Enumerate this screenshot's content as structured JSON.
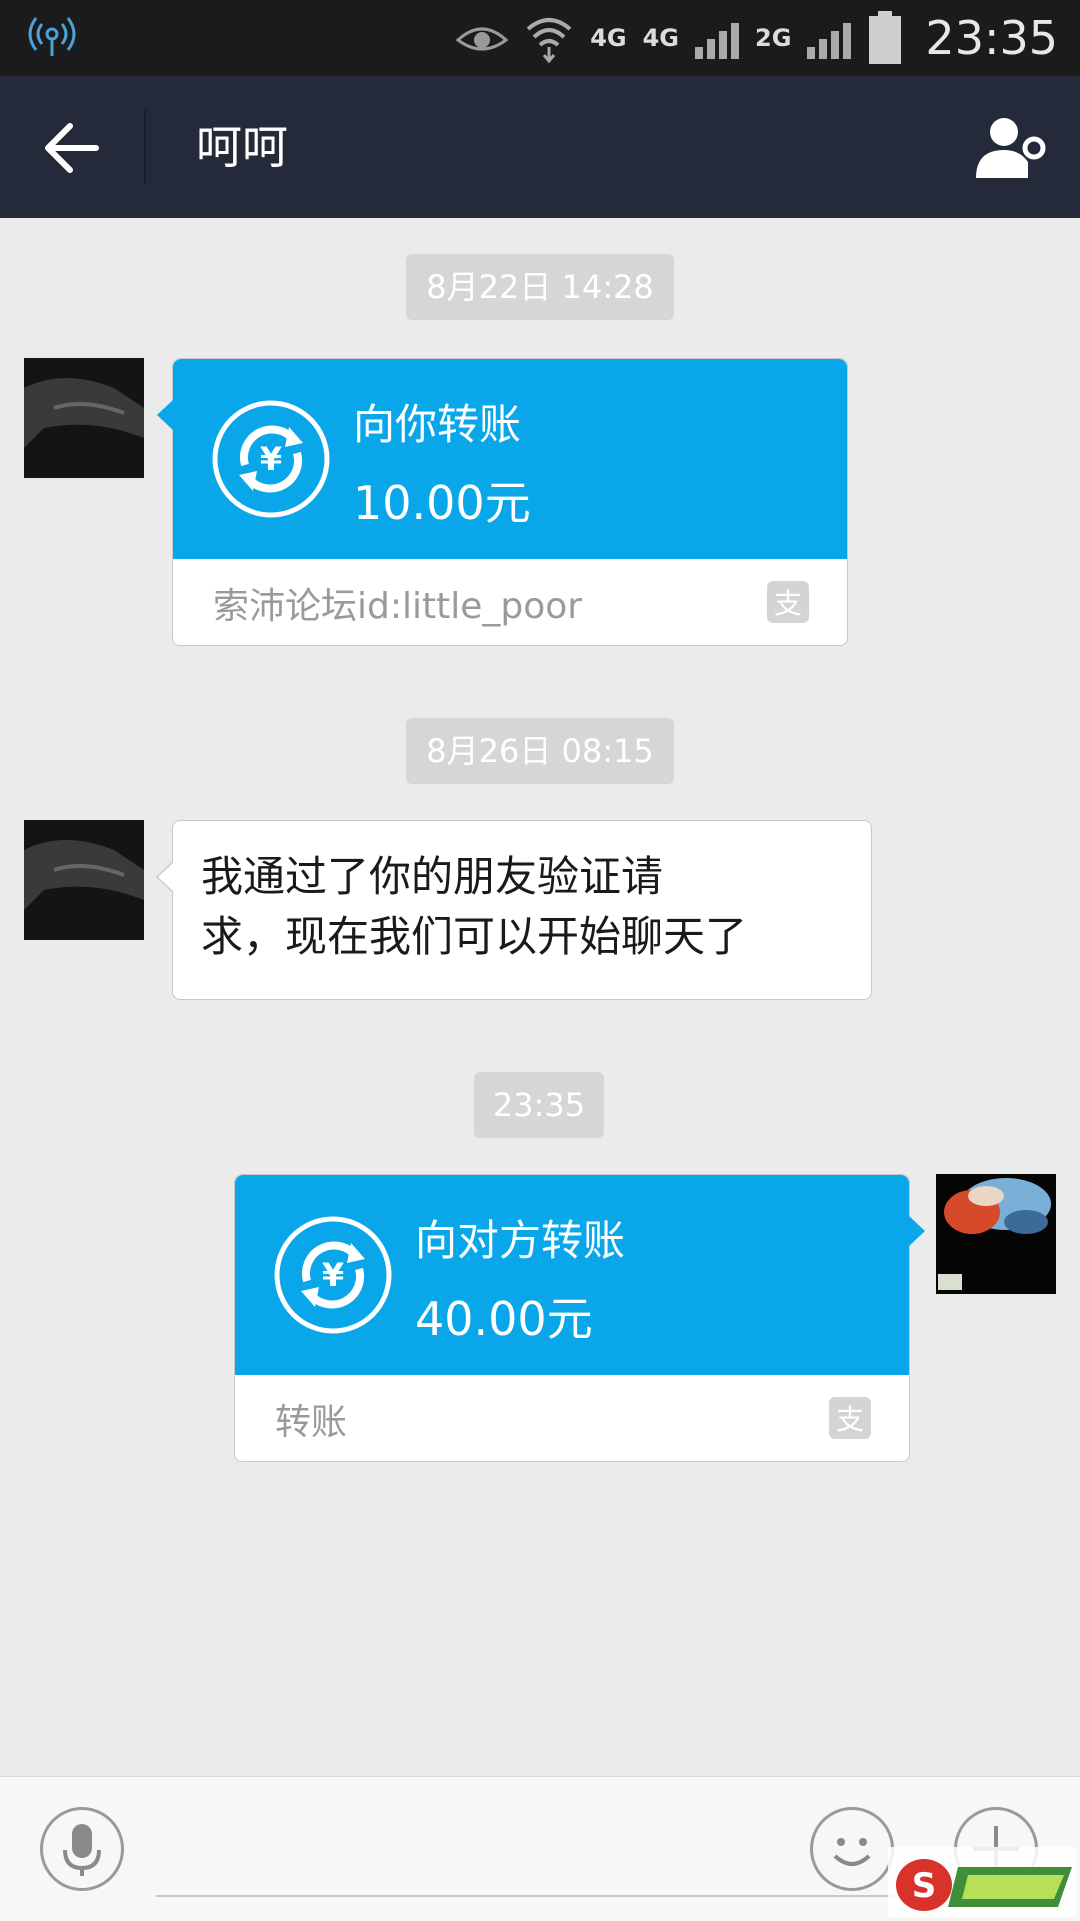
{
  "status_bar": {
    "time": "23:35",
    "network_labels": [
      "4G",
      "4G",
      "2G"
    ]
  },
  "header": {
    "title": "呵呵"
  },
  "messages": [
    {
      "timestamp": "8月22日 14:28",
      "type": "transfer",
      "direction": "incoming",
      "title": "向你转账",
      "amount": "10.00元",
      "note": "索沛论坛id:little_poor"
    },
    {
      "timestamp": "8月26日 08:15",
      "type": "text",
      "direction": "incoming",
      "line1": "我通过了你的朋友验证请",
      "line2": "求，现在我们可以开始聊天了"
    },
    {
      "timestamp": "23:35",
      "type": "transfer",
      "direction": "outgoing",
      "title": "向对方转账",
      "amount": "40.00元",
      "note": "转账"
    }
  ],
  "colors": {
    "accent": "#09a7ea",
    "title_bar": "#252a3a",
    "status_bar": "#1b1b1b",
    "chat_background": "#ebebeb"
  },
  "icons": {
    "back": "arrow-left-icon",
    "profile": "user-settings-icon",
    "transfer": "yuan-transfer-icon",
    "alipay": "alipay-icon",
    "voice": "microphone-icon",
    "emoji": "smiley-icon",
    "more": "plus-icon"
  }
}
